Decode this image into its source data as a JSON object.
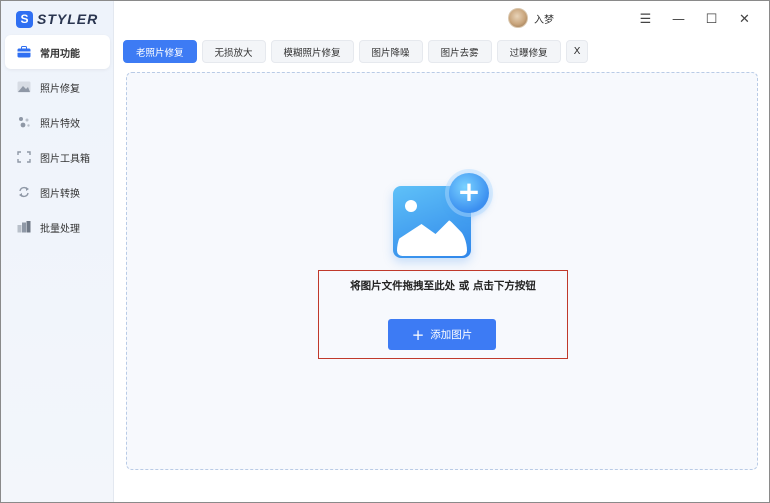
{
  "app": {
    "logo_mark": "S",
    "name": "STYLER"
  },
  "user": {
    "name": "入梦"
  },
  "window_controls": {
    "menu": "☰",
    "minimize": "—",
    "maximize": "☐",
    "close": "✕"
  },
  "sidebar": {
    "items": [
      {
        "label": "常用功能",
        "icon": "toolbox-icon",
        "active": true
      },
      {
        "label": "照片修复",
        "icon": "image-repair-icon",
        "active": false
      },
      {
        "label": "照片特效",
        "icon": "sparkle-effects-icon",
        "active": false
      },
      {
        "label": "图片工具箱",
        "icon": "crop-tools-icon",
        "active": false
      },
      {
        "label": "图片转换",
        "icon": "convert-icon",
        "active": false
      },
      {
        "label": "批量处理",
        "icon": "batch-icon",
        "active": false
      }
    ]
  },
  "tabs": {
    "items": [
      {
        "label": "老照片修复",
        "active": true
      },
      {
        "label": "无损放大",
        "active": false
      },
      {
        "label": "模糊照片修复",
        "active": false
      },
      {
        "label": "图片降噪",
        "active": false
      },
      {
        "label": "图片去雾",
        "active": false
      },
      {
        "label": "过曝修复",
        "active": false
      }
    ],
    "close_label": "X"
  },
  "dropzone": {
    "instruction": "将图片文件拖拽至此处 或 点击下方按钮",
    "button_icon": "+",
    "button_label": "添加图片",
    "badge_icon": "+"
  },
  "colors": {
    "accent": "#3d7bf4",
    "highlight": "#c0392b"
  }
}
